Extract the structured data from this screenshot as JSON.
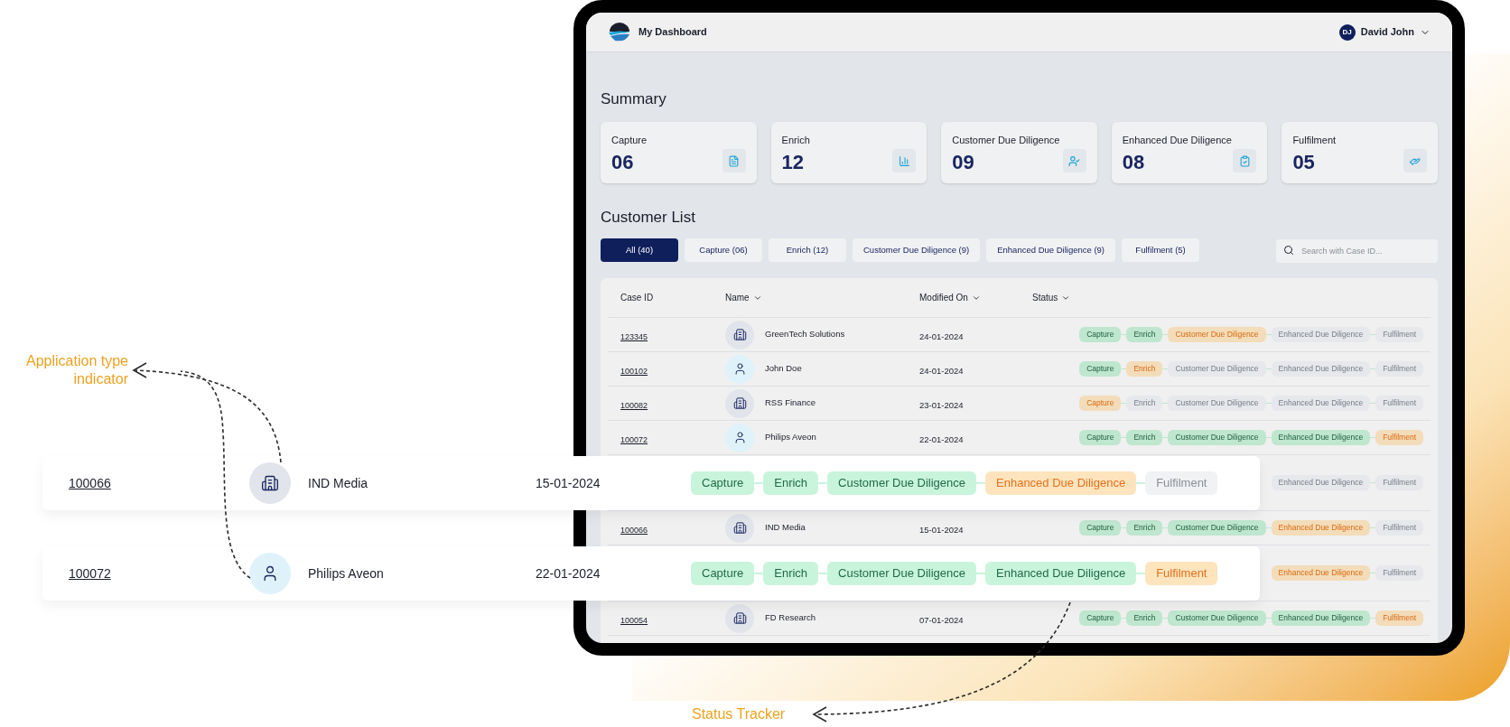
{
  "header": {
    "title": "My Dashboard",
    "user": {
      "initials": "DJ",
      "name": "David John"
    }
  },
  "summary": {
    "title": "Summary",
    "cards": [
      {
        "label": "Capture",
        "count": "06"
      },
      {
        "label": "Enrich",
        "count": "12"
      },
      {
        "label": "Customer Due Diligence",
        "count": "09"
      },
      {
        "label": "Enhanced Due Diligence",
        "count": "08"
      },
      {
        "label": "Fulfilment",
        "count": "05"
      }
    ]
  },
  "customer_list": {
    "title": "Customer List",
    "filters": [
      {
        "label": "All (40)",
        "selected": true
      },
      {
        "label": "Capture (06)",
        "selected": false
      },
      {
        "label": "Enrich (12)",
        "selected": false
      },
      {
        "label": "Customer Due Diligence (9)",
        "selected": false
      },
      {
        "label": "Enhanced Due Diligence (9)",
        "selected": false
      },
      {
        "label": "Fulfilment (5)",
        "selected": false
      }
    ],
    "search": {
      "placeholder": "Search with Case ID..."
    },
    "table": {
      "columns": [
        {
          "label": "Case ID",
          "sortable": false
        },
        {
          "label": "Name",
          "sortable": true
        },
        {
          "label": "Modified On",
          "sortable": true
        },
        {
          "label": "Status",
          "sortable": true
        }
      ],
      "rows": [
        {
          "case_id": "123345",
          "kind": "company",
          "name": "GreenTech Solutions",
          "modified_on": "24-01-2024",
          "statuses": [
            {
              "label": "Capture",
              "done": true,
              "current": false
            },
            {
              "label": "Enrich",
              "done": true,
              "current": false
            },
            {
              "label": "Customer Due Diligence",
              "done": false,
              "current": true
            },
            {
              "label": "Enhanced Due Diligence",
              "done": false,
              "current": false
            },
            {
              "label": "Fulfilment",
              "done": false,
              "current": false
            }
          ]
        },
        {
          "case_id": "100102",
          "kind": "person",
          "name": "John Doe",
          "modified_on": "24-01-2024",
          "statuses": [
            {
              "label": "Capture",
              "done": true,
              "current": false
            },
            {
              "label": "Enrich",
              "done": false,
              "current": true
            },
            {
              "label": "Customer Due Diligence",
              "done": false,
              "current": false
            },
            {
              "label": "Enhanced Due Diligence",
              "done": false,
              "current": false
            },
            {
              "label": "Fulfilment",
              "done": false,
              "current": false
            }
          ]
        },
        {
          "case_id": "100082",
          "kind": "company",
          "name": "RSS Finance",
          "modified_on": "23-01-2024",
          "statuses": [
            {
              "label": "Capture",
              "done": false,
              "current": true
            },
            {
              "label": "Enrich",
              "done": false,
              "current": false
            },
            {
              "label": "Customer Due Diligence",
              "done": false,
              "current": false
            },
            {
              "label": "Enhanced Due Diligence",
              "done": false,
              "current": false
            },
            {
              "label": "Fulfilment",
              "done": false,
              "current": false
            }
          ]
        },
        {
          "case_id": "100072",
          "kind": "person",
          "name": "Philips Aveon",
          "modified_on": "22-01-2024",
          "statuses": [
            {
              "label": "Capture",
              "done": true,
              "current": false
            },
            {
              "label": "Enrich",
              "done": true,
              "current": false
            },
            {
              "label": "Customer Due Diligence",
              "done": true,
              "current": false
            },
            {
              "label": "Enhanced Due Diligence",
              "done": true,
              "current": false
            },
            {
              "label": "Fulfilment",
              "done": false,
              "current": true
            }
          ]
        },
        {
          "statuses": [
            {
              "label": "Enhanced Due Diligence",
              "done": false,
              "current": false
            },
            {
              "label": "Fulfilment",
              "done": false,
              "current": false
            }
          ]
        },
        {
          "case_id": "100066",
          "kind": "company",
          "name": "IND Media",
          "modified_on": "15-01-2024",
          "statuses": [
            {
              "label": "Capture",
              "done": true,
              "current": false
            },
            {
              "label": "Enrich",
              "done": true,
              "current": false
            },
            {
              "label": "Customer Due Diligence",
              "done": true,
              "current": false
            },
            {
              "label": "Enhanced Due Diligence",
              "done": false,
              "current": true
            },
            {
              "label": "Fulfilment",
              "done": false,
              "current": false
            }
          ]
        },
        {
          "statuses": [
            {
              "label": "Enhanced Due Diligence",
              "done": false,
              "current": true
            },
            {
              "label": "Fulfilment",
              "done": false,
              "current": false
            }
          ]
        },
        {
          "case_id": "100054",
          "kind": "company",
          "name": "FD Research",
          "modified_on": "07-01-2024",
          "statuses": [
            {
              "label": "Capture",
              "done": true,
              "current": false
            },
            {
              "label": "Enrich",
              "done": true,
              "current": false
            },
            {
              "label": "Customer Due Diligence",
              "done": true,
              "current": false
            },
            {
              "label": "Enhanced Due Diligence",
              "done": true,
              "current": false
            },
            {
              "label": "Fulfilment",
              "done": false,
              "current": true
            }
          ]
        }
      ]
    }
  },
  "highlights": [
    {
      "case_id": "100066",
      "kind": "company",
      "name": "IND Media",
      "modified_on": "15-01-2024",
      "statuses": [
        {
          "label": "Capture",
          "done": true,
          "current": false
        },
        {
          "label": "Enrich",
          "done": true,
          "current": false
        },
        {
          "label": "Customer Due Diligence",
          "done": true,
          "current": false
        },
        {
          "label": "Enhanced Due Diligence",
          "done": false,
          "current": true
        },
        {
          "label": "Fulfilment",
          "done": false,
          "current": false
        }
      ]
    },
    {
      "case_id": "100072",
      "kind": "person",
      "name": "Philips Aveon",
      "modified_on": "22-01-2024",
      "statuses": [
        {
          "label": "Capture",
          "done": true,
          "current": false
        },
        {
          "label": "Enrich",
          "done": true,
          "current": false
        },
        {
          "label": "Customer Due Diligence",
          "done": true,
          "current": false
        },
        {
          "label": "Enhanced Due Diligence",
          "done": true,
          "current": false
        },
        {
          "label": "Fulfilment",
          "done": false,
          "current": true
        }
      ]
    }
  ],
  "annotations": [
    {
      "text": "Application type indicator"
    },
    {
      "text": "Status Tracker"
    }
  ]
}
